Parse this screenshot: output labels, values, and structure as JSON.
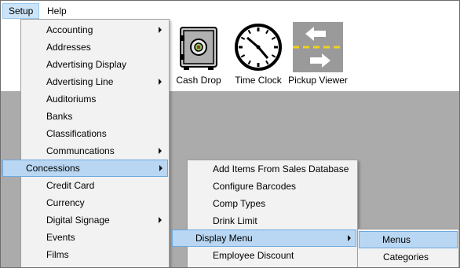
{
  "menubar": {
    "items": [
      {
        "label": "Setup"
      },
      {
        "label": "Help"
      }
    ]
  },
  "toolbar": {
    "buttons": [
      {
        "label": "Cash Drop",
        "icon": "safe-icon"
      },
      {
        "label": "Time Clock",
        "icon": "clock-icon"
      },
      {
        "label": "Pickup Viewer",
        "icon": "pickup-arrows-icon"
      }
    ]
  },
  "setup_menu": {
    "items": [
      {
        "label": "Accounting",
        "submenu": true
      },
      {
        "label": "Addresses",
        "submenu": false
      },
      {
        "label": "Advertising Display",
        "submenu": false
      },
      {
        "label": "Advertising Line",
        "submenu": true
      },
      {
        "label": "Auditoriums",
        "submenu": false
      },
      {
        "label": "Banks",
        "submenu": false
      },
      {
        "label": "Classifications",
        "submenu": false
      },
      {
        "label": "Communcations",
        "submenu": true
      },
      {
        "label": "Concessions",
        "submenu": true,
        "highlighted": true
      },
      {
        "label": "Credit Card",
        "submenu": false
      },
      {
        "label": "Currency",
        "submenu": false
      },
      {
        "label": "Digital Signage",
        "submenu": true
      },
      {
        "label": "Events",
        "submenu": false
      },
      {
        "label": "Films",
        "submenu": false
      }
    ]
  },
  "concessions_menu": {
    "items": [
      {
        "label": "Add Items From Sales Database",
        "submenu": false
      },
      {
        "label": "Configure Barcodes",
        "submenu": false
      },
      {
        "label": "Comp Types",
        "submenu": false
      },
      {
        "label": "Drink Limit",
        "submenu": false
      },
      {
        "label": "Display Menu",
        "submenu": true,
        "highlighted": true
      },
      {
        "label": "Employee Discount",
        "submenu": false
      }
    ]
  },
  "display_menu": {
    "items": [
      {
        "label": "Menus",
        "highlighted": true
      },
      {
        "label": "Categories"
      }
    ]
  },
  "colors": {
    "menu_highlight": "#b9d7f3",
    "menu_highlight_border": "#6ea8dc",
    "menubar_active": "#cce4f7",
    "workspace": "#ababab",
    "menu_background": "#f2f2f2"
  }
}
